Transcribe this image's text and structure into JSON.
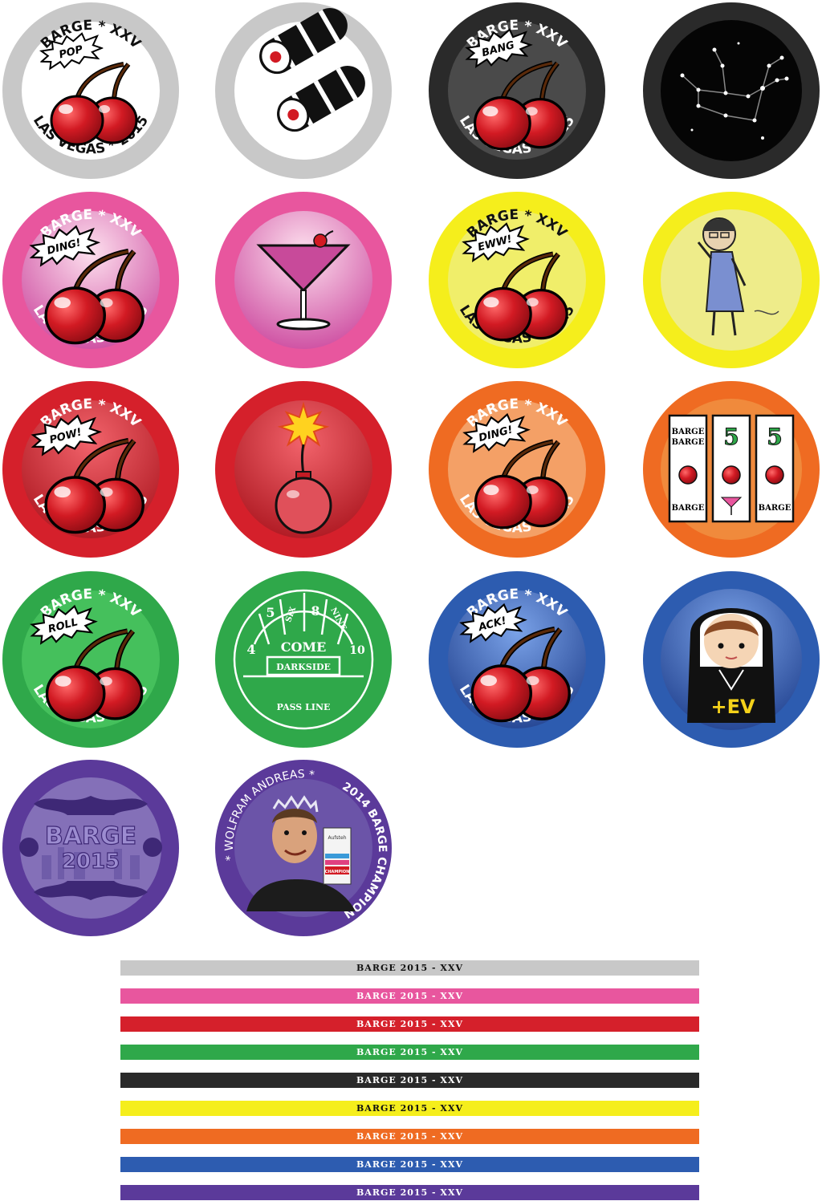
{
  "colors": {
    "gray": "#c8c8c8",
    "black": "#2a2a2a",
    "pink": "#e8569e",
    "yellow": "#f5ee1c",
    "red": "#d5202b",
    "orange": "#ef6b22",
    "green": "#2fa84a",
    "blue": "#2d5cb0",
    "purple": "#5b3a9a",
    "cherry": "#d21a23"
  },
  "chips": {
    "pop": {
      "top": "BARGE * XXV",
      "burst": "POP",
      "bottom": "LAS VEGAS * 2015"
    },
    "bang": {
      "top": "BARGE * XXV",
      "burst": "BANG",
      "bottom": "LAS VEGAS * 2015"
    },
    "ding_pink": {
      "top": "BARGE * XXV",
      "burst": "DING!",
      "bottom": "LAS VEGAS * 2015"
    },
    "eww": {
      "top": "BARGE * XXV",
      "burst": "EWW!",
      "bottom": "LAS VEGAS * 2015"
    },
    "pow": {
      "top": "BARGE * XXV",
      "burst": "POW!",
      "bottom": "LAS VEGAS * 2015"
    },
    "ding_orange": {
      "top": "BARGE * XXV",
      "burst": "DING!",
      "bottom": "LAS VEGAS * 2015"
    },
    "roll": {
      "top": "BARGE * XXV",
      "burst": "ROLL",
      "bottom": "LAS VEGAS * 2015"
    },
    "ack": {
      "top": "BARGE * XXV",
      "burst": "ACK!",
      "bottom": "LAS VEGAS * 2015"
    },
    "slots": {
      "reel1_top": "BARGE",
      "reel1_mid": "BARGE",
      "reel1_bottom": "BARGE",
      "reel2_top": "5",
      "reel3_top": "5",
      "reel3_bottom": "BARGE"
    },
    "craps": {
      "n4": "4",
      "n5": "5",
      "six": "SIX",
      "n8": "8",
      "nine": "NINE",
      "n10": "10",
      "come": "COME",
      "darkside": "DARKSIDE",
      "pass": "PASS LINE"
    },
    "nun": {
      "label": "+EV"
    },
    "barge2015": {
      "line1": "BARGE",
      "line2": "2015"
    },
    "champion": {
      "top": "* WOLFRAM ANDREAS *",
      "right": "2014 BARGE CHAMPION",
      "badge": "CHAMPION",
      "lanyard": "Aufsteh"
    }
  },
  "ribbons": [
    {
      "label": "BARGE 2015 - XXV",
      "bg": "#c8c8c8",
      "fg": "#111111"
    },
    {
      "label": "BARGE 2015 - XXV",
      "bg": "#e8569e",
      "fg": "#ffffff"
    },
    {
      "label": "BARGE 2015 - XXV",
      "bg": "#d5202b",
      "fg": "#ffffff"
    },
    {
      "label": "BARGE 2015 - XXV",
      "bg": "#2fa84a",
      "fg": "#ffffff"
    },
    {
      "label": "BARGE 2015 - XXV",
      "bg": "#2a2a2a",
      "fg": "#ffffff"
    },
    {
      "label": "BARGE 2015 - XXV",
      "bg": "#f5ee1c",
      "fg": "#111111"
    },
    {
      "label": "BARGE 2015 - XXV",
      "bg": "#ef6b22",
      "fg": "#ffffff"
    },
    {
      "label": "BARGE 2015 - XXV",
      "bg": "#2d5cb0",
      "fg": "#ffffff"
    },
    {
      "label": "BARGE 2015 - XXV",
      "bg": "#5b3a9a",
      "fg": "#ffffff"
    }
  ]
}
